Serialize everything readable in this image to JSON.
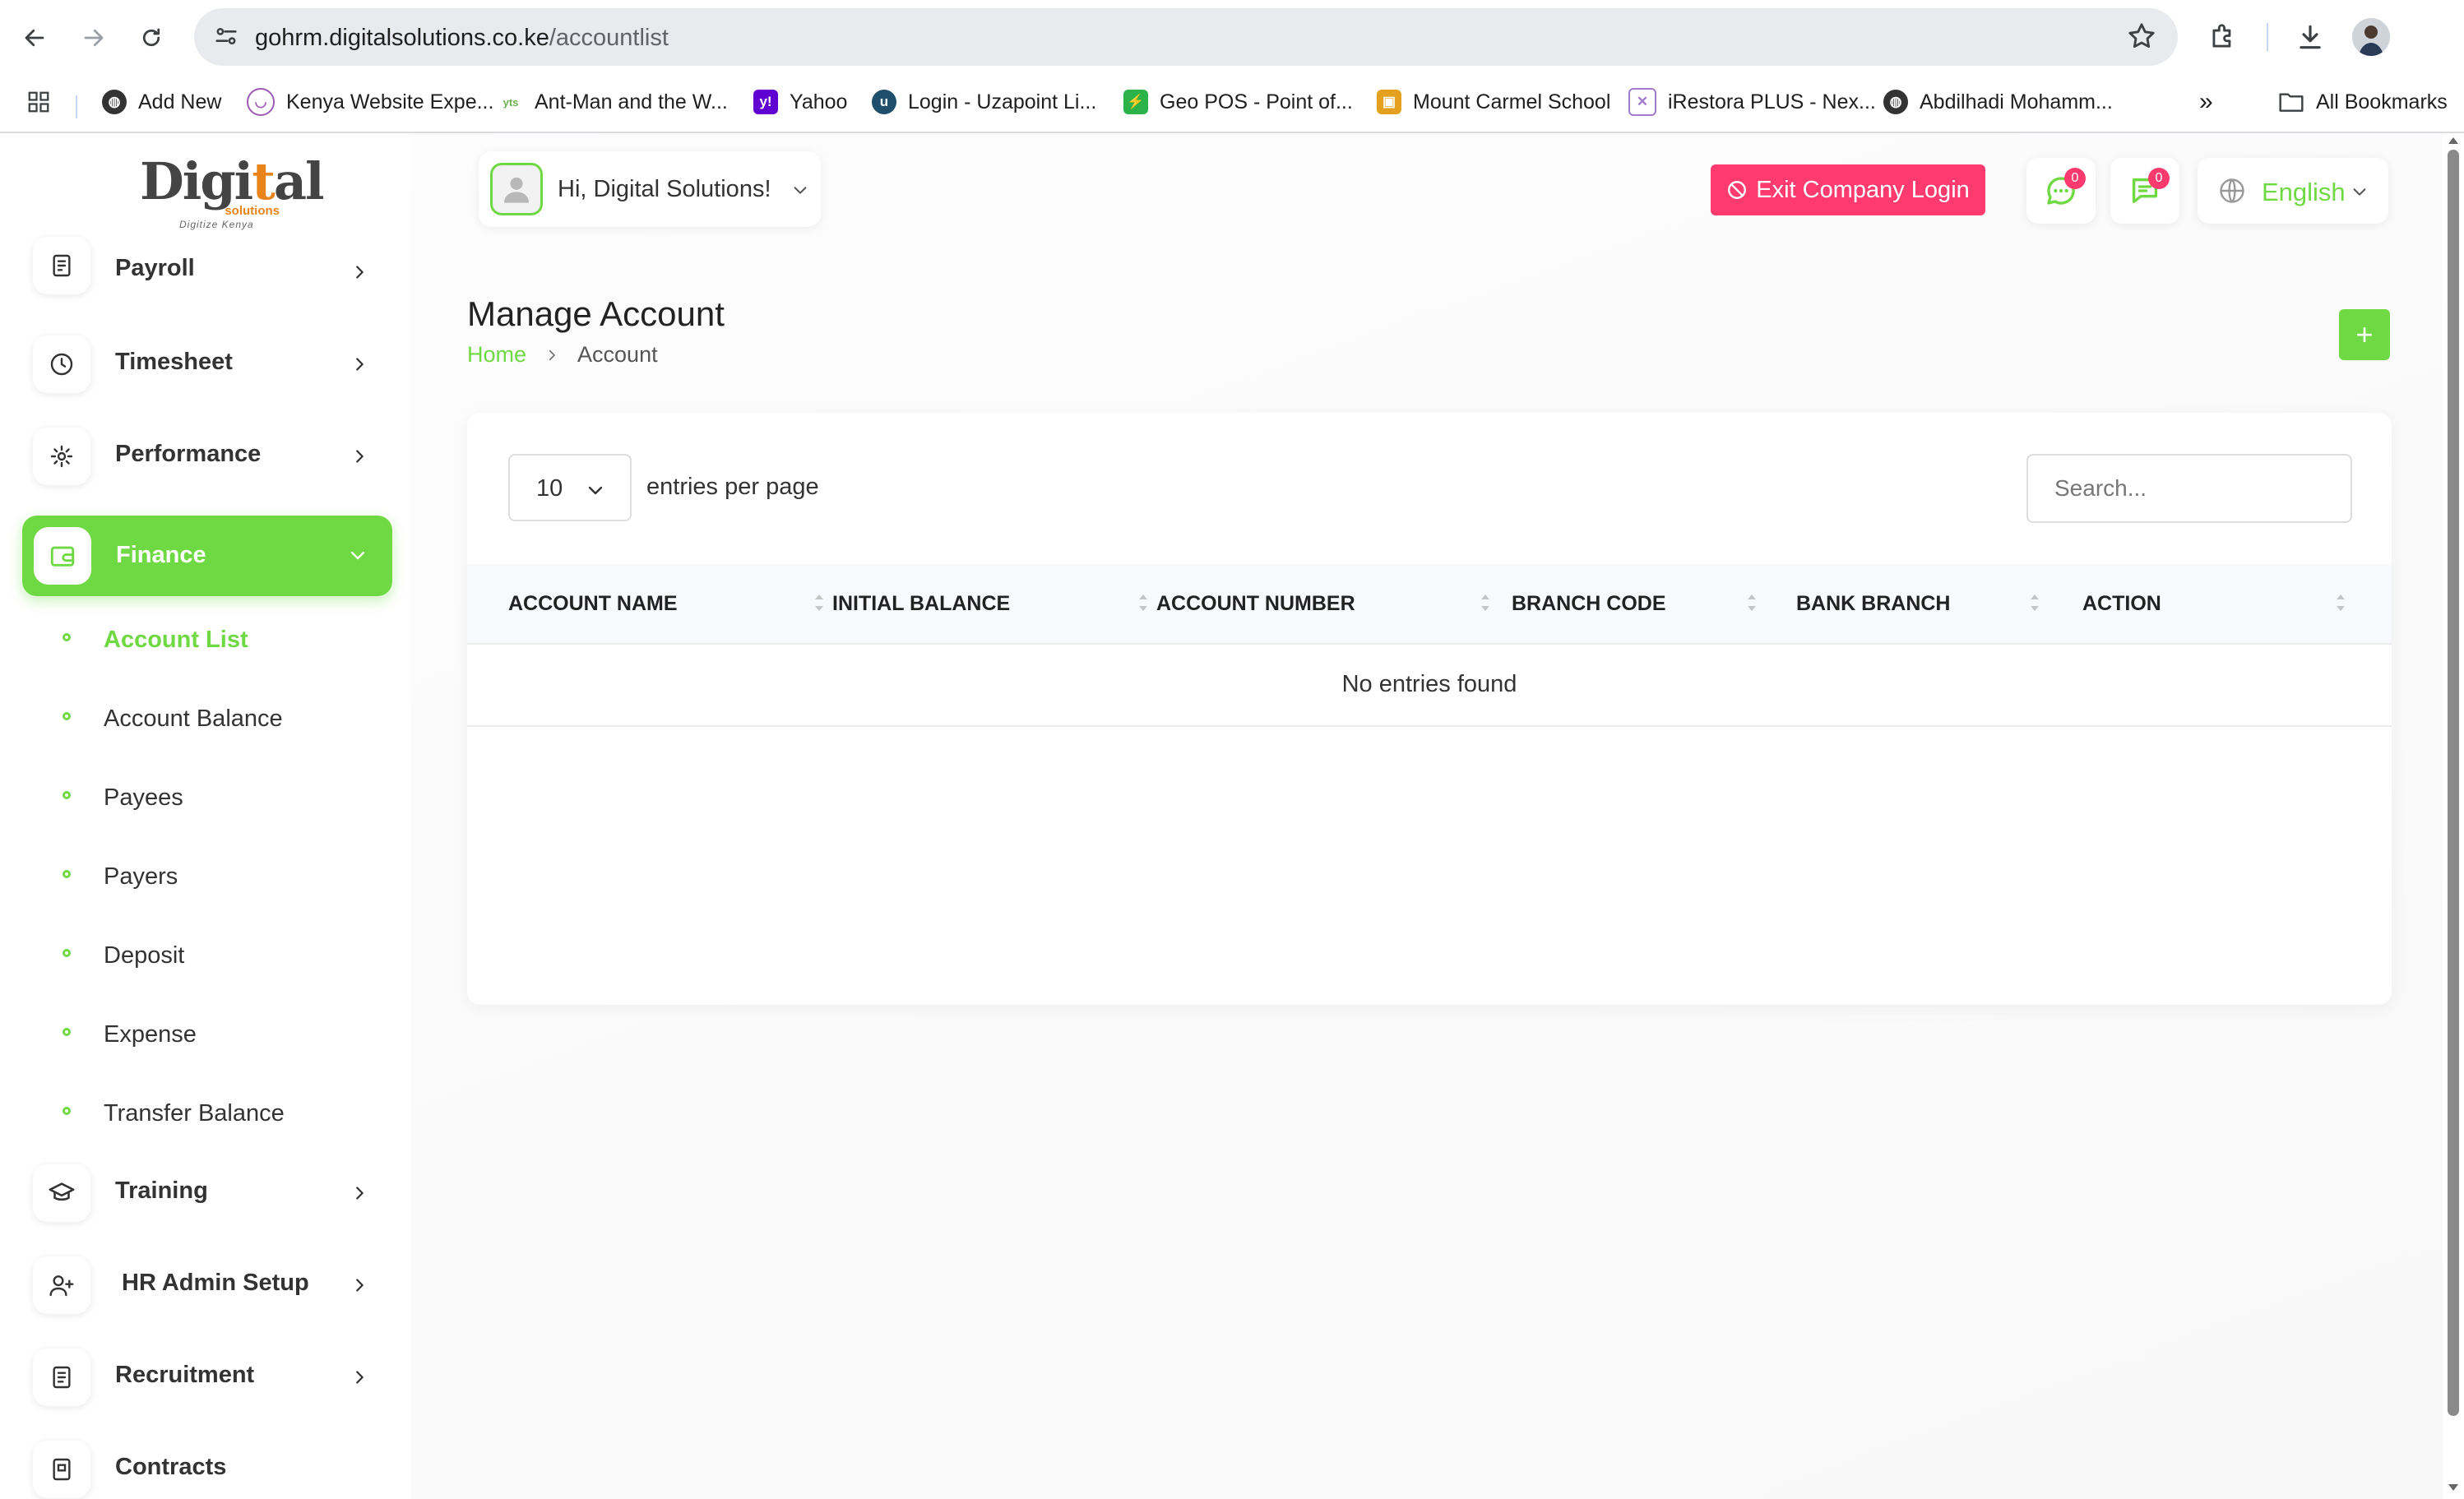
{
  "browser": {
    "url_host": "gohrm.digitalsolutions.co.ke",
    "url_path": "/accountlist",
    "bookmarks": [
      {
        "label": "Add New",
        "icon": "globe-icon",
        "color": "#333333"
      },
      {
        "label": "Kenya Website Expe...",
        "icon": "kenya-icon",
        "color": "#9c5ab5"
      },
      {
        "label": "Ant-Man and the W...",
        "icon": "yts-icon",
        "color": "#6ab04c"
      },
      {
        "label": "Yahoo",
        "icon": "yahoo-icon",
        "color": "#6001d2"
      },
      {
        "label": "Login - Uzapoint Li...",
        "icon": "uzapoint-icon",
        "color": "#1f4f6b"
      },
      {
        "label": "Geo POS - Point of...",
        "icon": "geopos-icon",
        "color": "#2bb34a"
      },
      {
        "label": "Mount Carmel School",
        "icon": "school-icon",
        "color": "#e6a020"
      },
      {
        "label": "iRestora PLUS - Nex...",
        "icon": "irestora-icon",
        "color": "#a07acc"
      },
      {
        "label": "Abdilhadi Mohamm...",
        "icon": "globe-icon",
        "color": "#333333"
      }
    ],
    "all_bookmarks": "All Bookmarks"
  },
  "brand": {
    "logo_word": "Digital",
    "logo_sub": "solutions",
    "logo_tag": "Digitize Kenya"
  },
  "sidebar": {
    "items_top": [
      {
        "label": "Payroll",
        "icon": "payroll-icon"
      },
      {
        "label": "Timesheet",
        "icon": "clock-icon"
      },
      {
        "label": "Performance",
        "icon": "performance-icon"
      }
    ],
    "active": {
      "label": "Finance",
      "icon": "wallet-icon"
    },
    "sub_items": [
      {
        "label": "Account List",
        "current": true
      },
      {
        "label": "Account Balance"
      },
      {
        "label": "Payees"
      },
      {
        "label": "Payers"
      },
      {
        "label": "Deposit"
      },
      {
        "label": "Expense"
      },
      {
        "label": "Transfer Balance"
      }
    ],
    "items_bottom": [
      {
        "label": "Training",
        "icon": "graduation-cap-icon"
      },
      {
        "label": "HR Admin Setup",
        "icon": "user-plus-icon"
      },
      {
        "label": "Recruitment",
        "icon": "recruitment-icon"
      },
      {
        "label": "Contracts",
        "icon": "contract-icon"
      }
    ]
  },
  "header": {
    "greeting": "Hi, Digital Solutions!",
    "exit_label": "Exit Company Login",
    "messages_count": "0",
    "chat_count": "0",
    "language": "English"
  },
  "page": {
    "title": "Manage Account",
    "breadcrumb_home": "Home",
    "breadcrumb_current": "Account",
    "add_label": "+"
  },
  "table": {
    "per_page_value": "10",
    "per_page_label": "entries per page",
    "search_placeholder": "Search...",
    "columns": [
      "ACCOUNT NAME",
      "INITIAL BALANCE",
      "ACCOUNT NUMBER",
      "BRANCH CODE",
      "BANK BRANCH",
      "ACTION"
    ],
    "empty_message": "No entries found"
  },
  "colors": {
    "accent": "#6fd943",
    "danger": "#ff3a6e"
  }
}
